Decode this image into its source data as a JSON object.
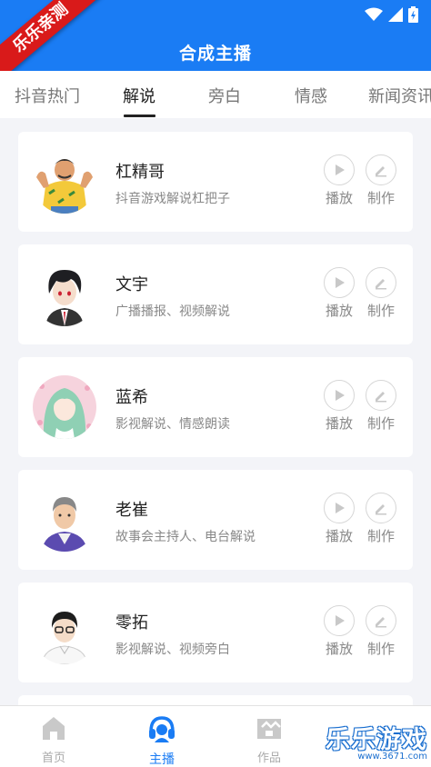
{
  "header": {
    "title": "合成主播"
  },
  "ribbon": {
    "text": "乐乐亲测"
  },
  "tabs": [
    {
      "label": "抖音热门"
    },
    {
      "label": "解说"
    },
    {
      "label": "旁白"
    },
    {
      "label": "情感"
    },
    {
      "label": "新闻资讯"
    }
  ],
  "anchors": [
    {
      "name": "杠精哥",
      "desc": "抖音游戏解说杠把子",
      "play": "播放",
      "make": "制作"
    },
    {
      "name": "文宇",
      "desc": "广播播报、视频解说",
      "play": "播放",
      "make": "制作"
    },
    {
      "name": "蓝希",
      "desc": "影视解说、情感朗读",
      "play": "播放",
      "make": "制作"
    },
    {
      "name": "老崔",
      "desc": "故事会主持人、电台解说",
      "play": "播放",
      "make": "制作"
    },
    {
      "name": "零拓",
      "desc": "影视解说、视频旁白",
      "play": "播放",
      "make": "制作"
    }
  ],
  "bottom_nav": [
    {
      "label": "首页",
      "icon": "home-icon"
    },
    {
      "label": "主播",
      "icon": "headset-icon"
    },
    {
      "label": "作品",
      "icon": "works-icon"
    }
  ],
  "watermark": {
    "title": "乐乐游戏",
    "url": "www.3671.com"
  },
  "colors": {
    "primary": "#1a7cf4",
    "ribbon": "#d91a1a"
  }
}
